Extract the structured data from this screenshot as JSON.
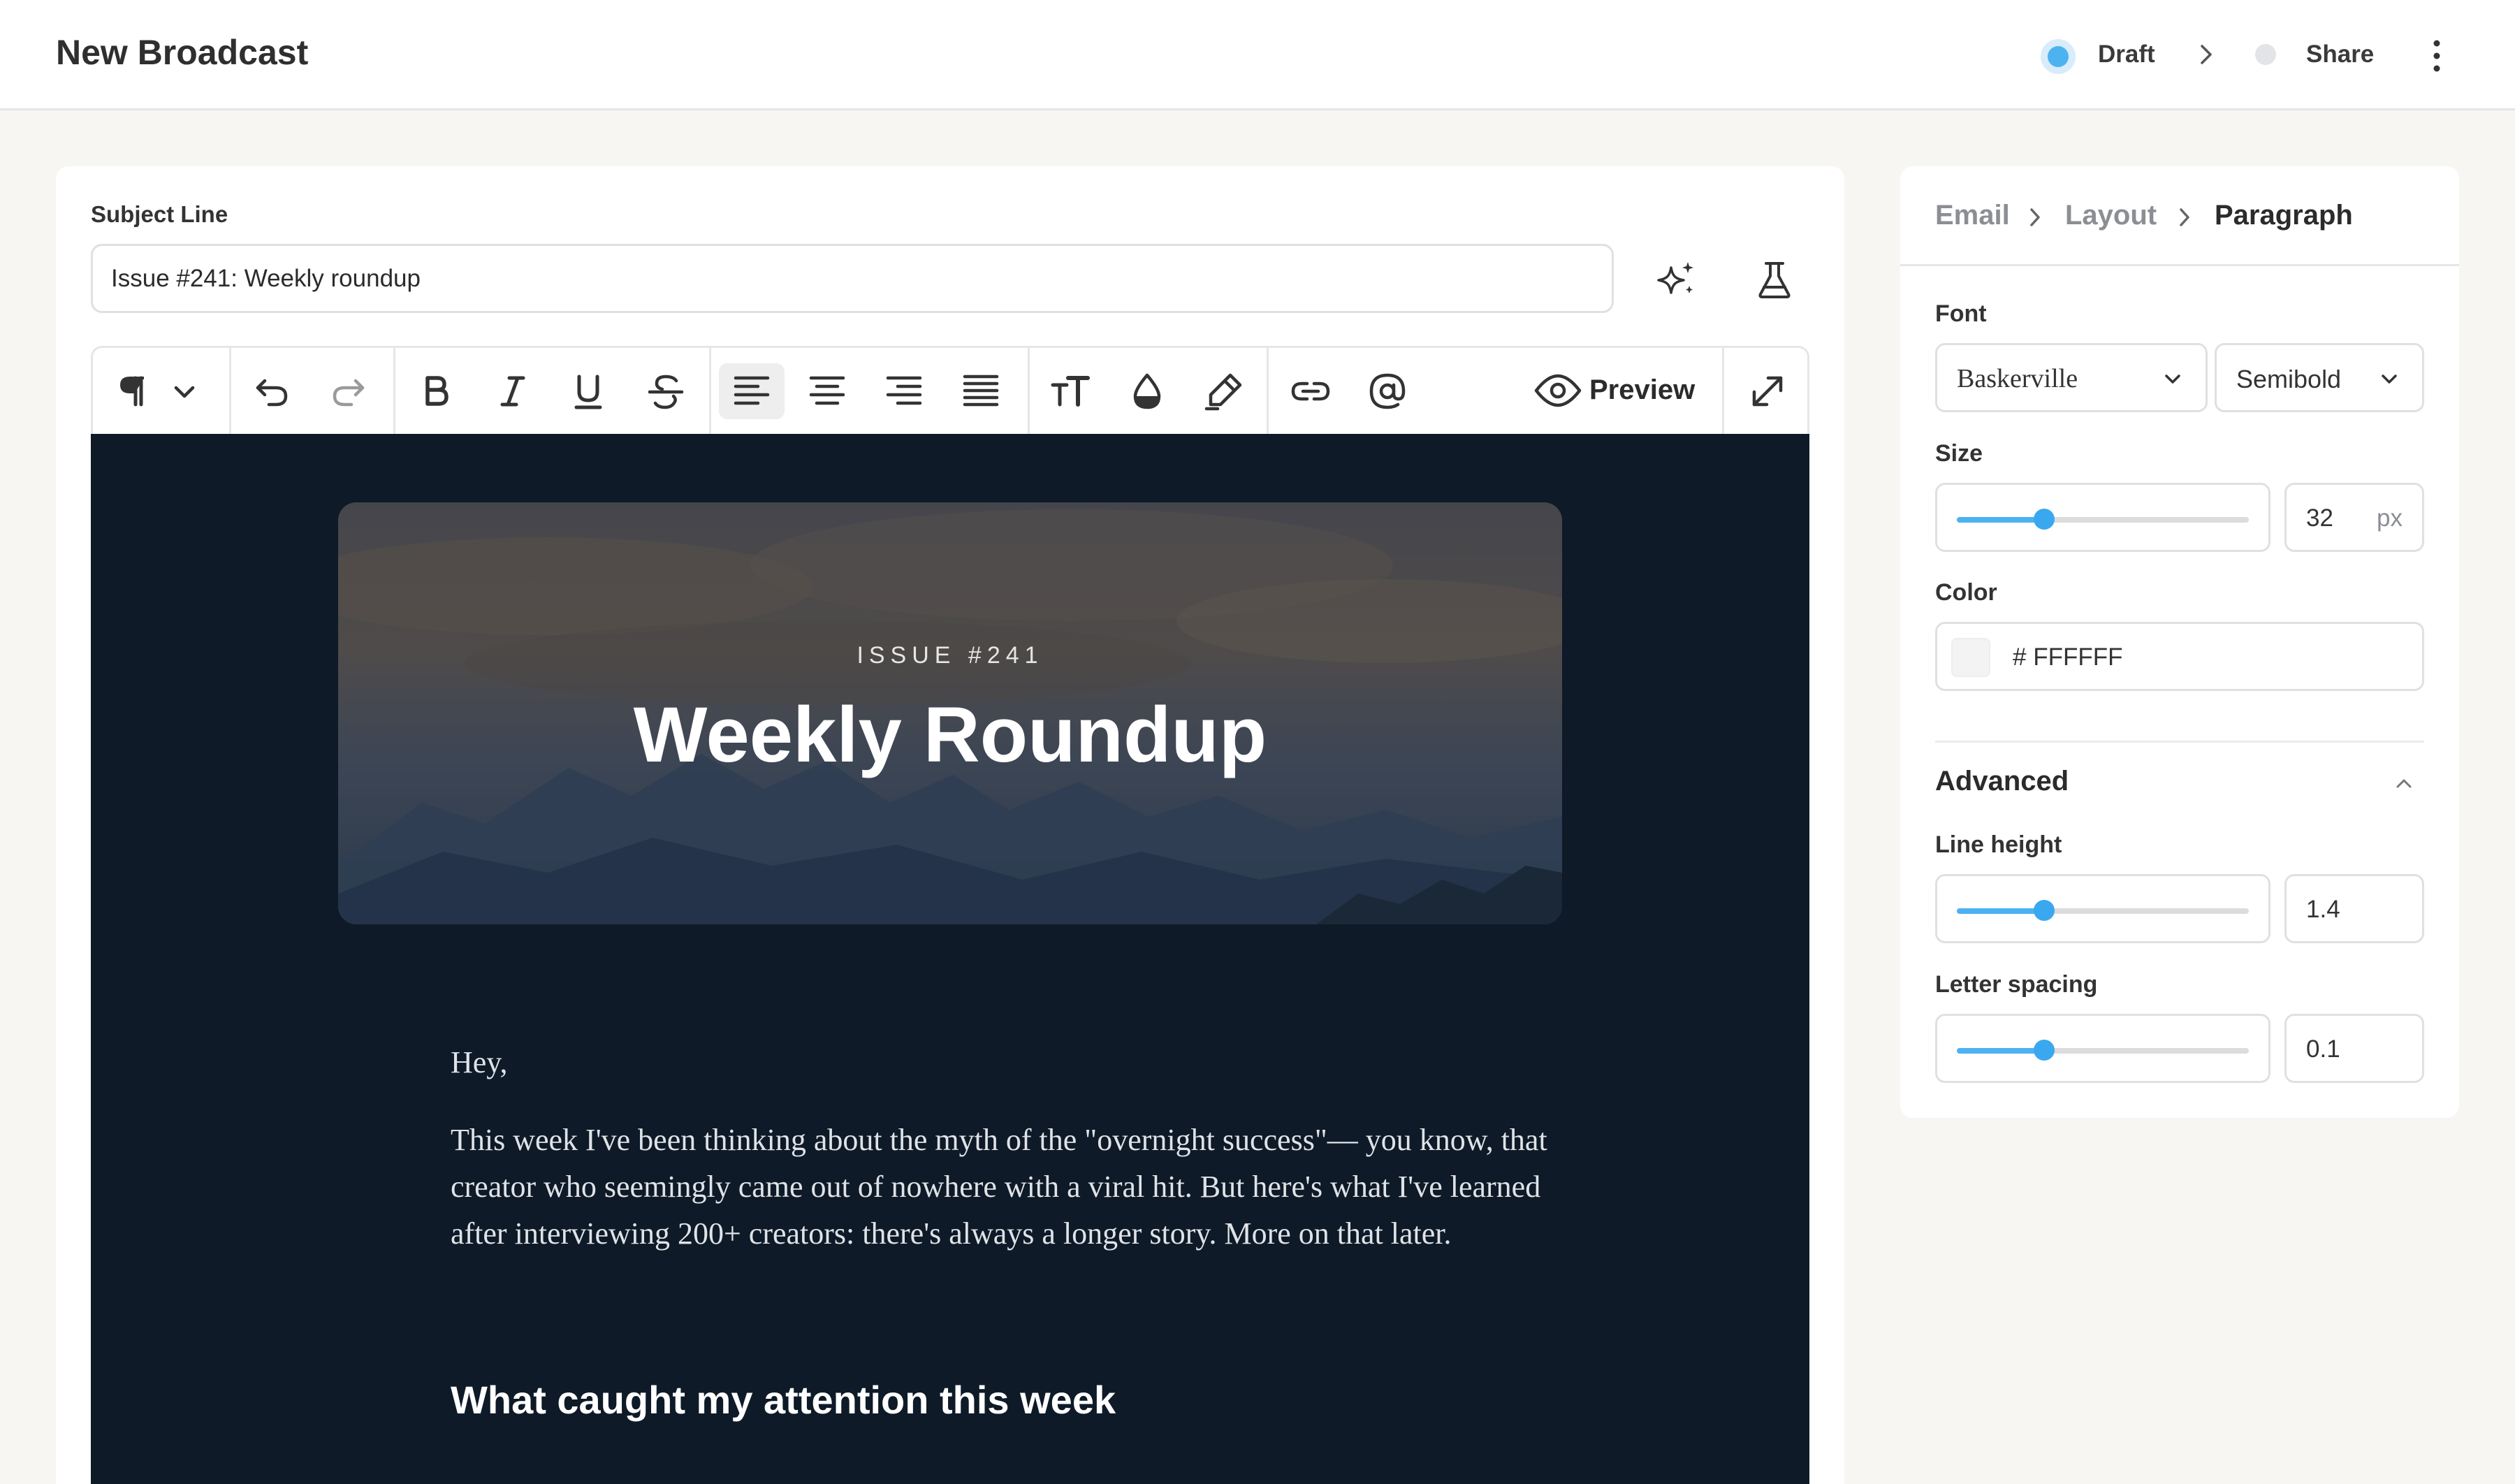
{
  "header": {
    "title": "New Broadcast",
    "steps": [
      {
        "label": "Draft",
        "state": "active"
      },
      {
        "label": "Share",
        "state": "pending"
      }
    ],
    "accent": "#4db2f0"
  },
  "subject": {
    "label": "Subject Line",
    "value": "Issue #241: Weekly roundup"
  },
  "toolbar": {
    "preview_label": "Preview",
    "active_alignment": "align-left"
  },
  "email": {
    "hero": {
      "kicker": "ISSUE #241",
      "title": "Weekly Roundup"
    },
    "greeting": "Hey,",
    "paragraph": "This week I've been thinking about the myth of the \"overnight success\"— you know, that creator who seemingly came out of nowhere with a viral hit. But here's what I've learned after interviewing 200+ creators: there's always a longer story. More on that later.",
    "subheading": "What caught my attention this week",
    "background": "#0e1a27"
  },
  "panel": {
    "breadcrumbs": [
      "Email",
      "Layout",
      "Paragraph"
    ],
    "font": {
      "label": "Font",
      "family": "Baskerville",
      "weight": "Semibold"
    },
    "size": {
      "label": "Size",
      "value": "32",
      "unit": "px",
      "slider_fraction": 0.3
    },
    "color": {
      "label": "Color",
      "hex": "# FFFFFF"
    },
    "advanced": {
      "title": "Advanced",
      "expanded": true,
      "line_height": {
        "label": "Line height",
        "value": "1.4",
        "slider_fraction": 0.3
      },
      "letter_spacing": {
        "label": "Letter spacing",
        "value": "0.1",
        "slider_fraction": 0.3
      }
    }
  }
}
